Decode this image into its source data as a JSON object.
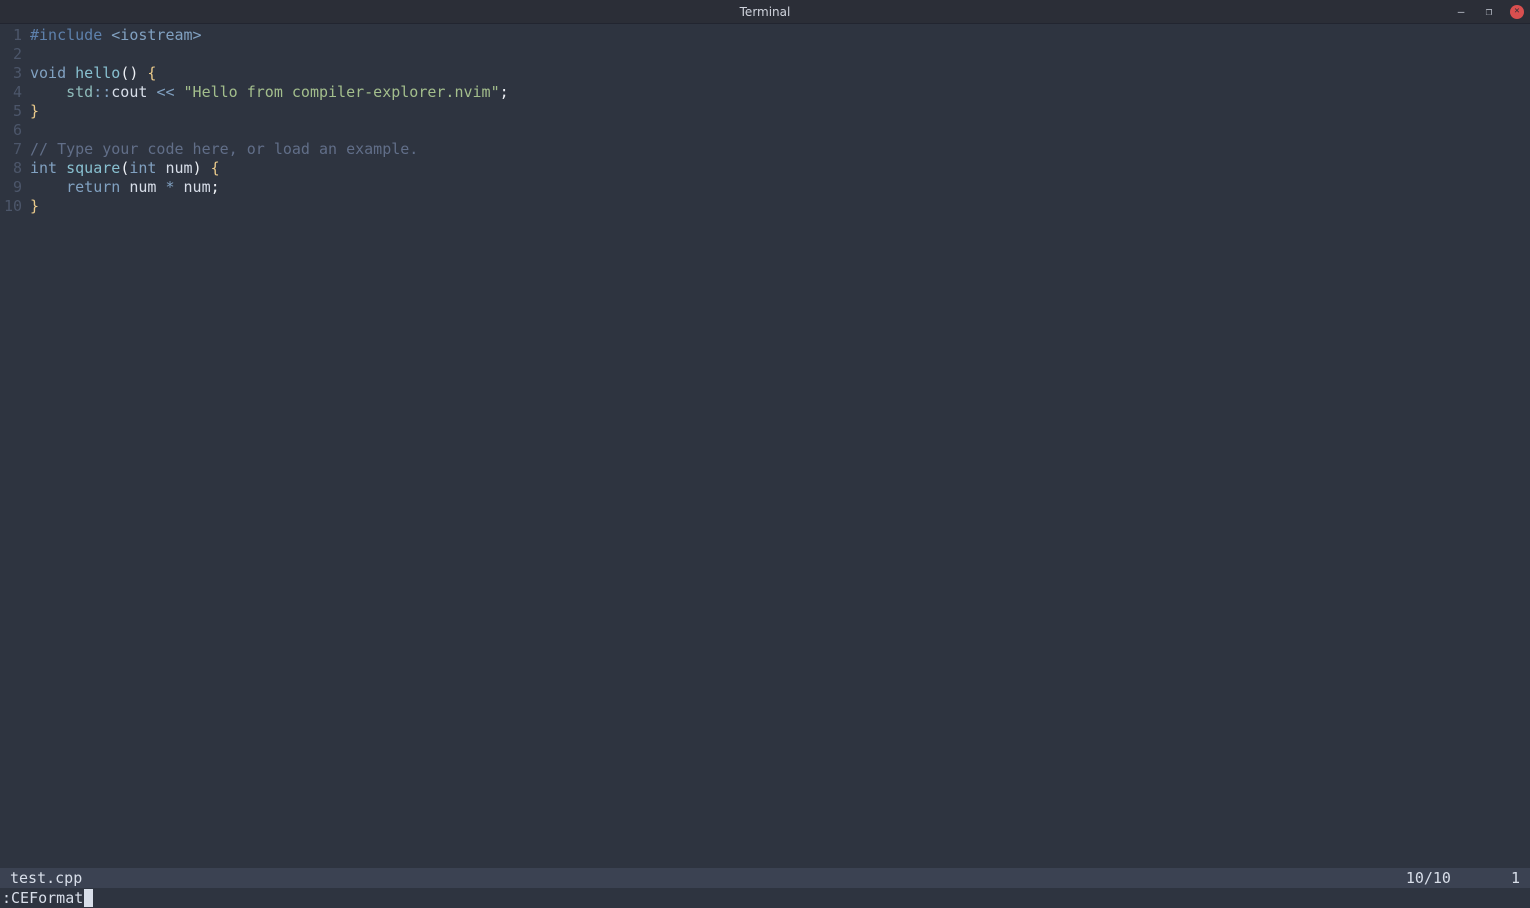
{
  "window": {
    "title": "Terminal",
    "controls": {
      "minimize": "–",
      "maximize": "❐",
      "close": "✕"
    }
  },
  "editor": {
    "lines": [
      {
        "n": "1",
        "tokens": [
          {
            "c": "pre",
            "t": "#include"
          },
          {
            "c": "id",
            "t": " "
          },
          {
            "c": "angle",
            "t": "<iostream>"
          }
        ]
      },
      {
        "n": "2",
        "tokens": [
          {
            "c": "id",
            "t": ""
          }
        ]
      },
      {
        "n": "3",
        "tokens": [
          {
            "c": "kw",
            "t": "void"
          },
          {
            "c": "id",
            "t": " "
          },
          {
            "c": "fn",
            "t": "hello"
          },
          {
            "c": "paren",
            "t": "()"
          },
          {
            "c": "id",
            "t": " "
          },
          {
            "c": "brace",
            "t": "{"
          }
        ]
      },
      {
        "n": "4",
        "tokens": [
          {
            "c": "id",
            "t": "    "
          },
          {
            "c": "ns",
            "t": "std"
          },
          {
            "c": "op",
            "t": "::"
          },
          {
            "c": "id",
            "t": "cout"
          },
          {
            "c": "id",
            "t": " "
          },
          {
            "c": "op",
            "t": "<<"
          },
          {
            "c": "id",
            "t": " "
          },
          {
            "c": "str",
            "t": "\"Hello from compiler-explorer.nvim\""
          },
          {
            "c": "punc",
            "t": ";"
          }
        ]
      },
      {
        "n": "5",
        "tokens": [
          {
            "c": "brace",
            "t": "}"
          }
        ]
      },
      {
        "n": "6",
        "tokens": [
          {
            "c": "id",
            "t": ""
          }
        ]
      },
      {
        "n": "7",
        "tokens": [
          {
            "c": "cmt",
            "t": "// Type your code here, or load an example."
          }
        ]
      },
      {
        "n": "8",
        "tokens": [
          {
            "c": "type",
            "t": "int"
          },
          {
            "c": "id",
            "t": " "
          },
          {
            "c": "fn",
            "t": "square"
          },
          {
            "c": "paren",
            "t": "("
          },
          {
            "c": "type",
            "t": "int"
          },
          {
            "c": "id",
            "t": " num"
          },
          {
            "c": "paren",
            "t": ")"
          },
          {
            "c": "id",
            "t": " "
          },
          {
            "c": "brace",
            "t": "{"
          }
        ]
      },
      {
        "n": "9",
        "tokens": [
          {
            "c": "id",
            "t": "    "
          },
          {
            "c": "kw",
            "t": "return"
          },
          {
            "c": "id",
            "t": " num "
          },
          {
            "c": "op",
            "t": "*"
          },
          {
            "c": "id",
            "t": " num"
          },
          {
            "c": "punc",
            "t": ";"
          }
        ]
      },
      {
        "n": "10",
        "tokens": [
          {
            "c": "brace",
            "t": "}"
          }
        ]
      }
    ]
  },
  "status": {
    "filename": "test.cpp",
    "position": "10/10",
    "column": "1"
  },
  "cmdline": {
    "text": ":CEFormat"
  }
}
